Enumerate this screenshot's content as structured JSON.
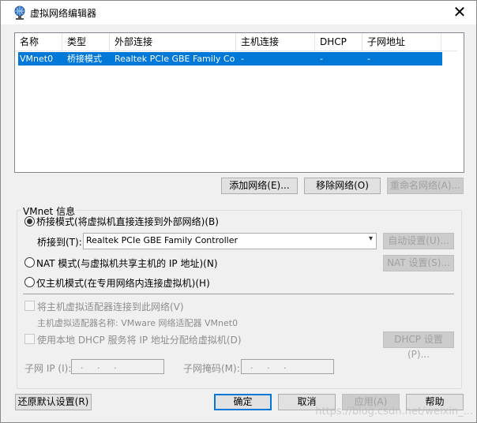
{
  "window": {
    "title": "虚拟网络编辑器"
  },
  "table": {
    "columns": [
      "名称",
      "类型",
      "外部连接",
      "主机连接",
      "DHCP",
      "子网地址"
    ],
    "rows": [
      {
        "name": "VMnet0",
        "type": "桥接模式",
        "external": "Realtek PCIe GBE Family Co...",
        "host": "-",
        "dhcp": "-",
        "subnet": "-"
      }
    ]
  },
  "buttons": {
    "add_network": "添加网络(E)...",
    "remove_network": "移除网络(O)",
    "rename_network": "重命名网络(A)...",
    "auto_settings": "自动设置(U)...",
    "nat_settings": "NAT 设置(S)...",
    "dhcp_settings": "DHCP 设置(P)...",
    "restore_defaults": "还原默认设置(R)",
    "ok": "确定",
    "cancel": "取消",
    "apply": "应用(A)",
    "help": "帮助"
  },
  "vmnet_info": {
    "group_label": "VMnet 信息",
    "bridged_radio": "桥接模式(将虚拟机直接连接到外部网络)(B)",
    "bridged_to_label": "桥接到(T):",
    "bridged_to_value": "Realtek PCIe GBE Family Controller",
    "nat_radio": "NAT 模式(与虚拟机共享主机的 IP 地址)(N)",
    "hostonly_radio": "仅主机模式(在专用网络内连接虚拟机)(H)",
    "connect_host_adapter": "将主机虚拟适配器连接到此网络(V)",
    "host_adapter_name": "主机虚拟适配器名称: VMware 网络适配器 VMnet0",
    "use_dhcp": "使用本地 DHCP 服务将 IP 地址分配给虚拟机(D)",
    "subnet_ip_label": "子网 IP (I):",
    "subnet_mask_label": "子网掩码(M):",
    "ip_dots": "  .     .     .  "
  },
  "watermark": "https://blog.csdn.net/weixin_..."
}
